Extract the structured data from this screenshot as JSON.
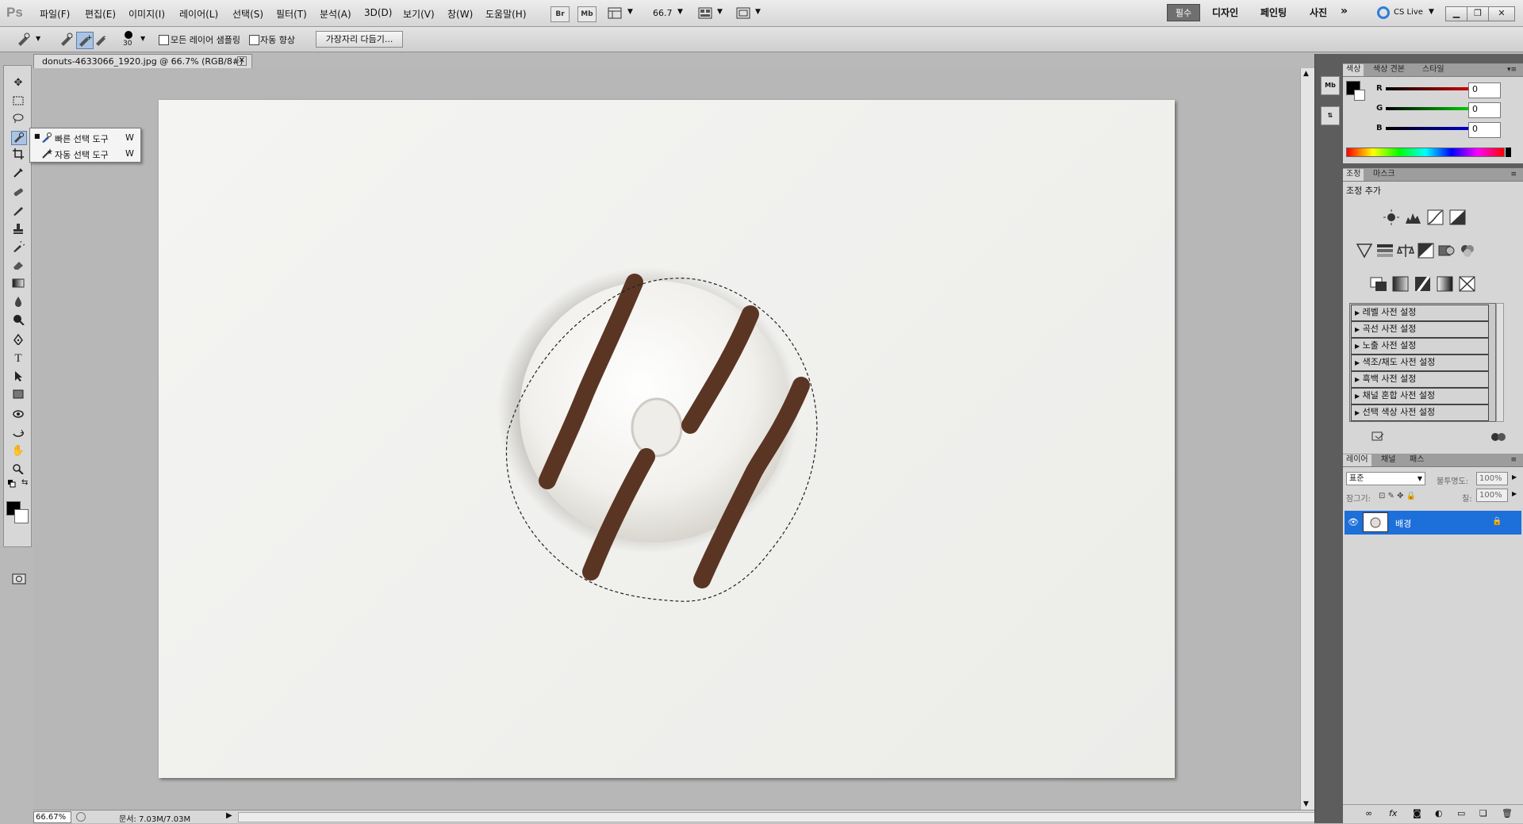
{
  "app": {
    "logo": "Ps"
  },
  "menu": [
    "파일(F)",
    "편집(E)",
    "이미지(I)",
    "레이어(L)",
    "선택(S)",
    "필터(T)",
    "분석(A)",
    "3D(D)",
    "보기(V)",
    "창(W)",
    "도움말(H)"
  ],
  "appbar": {
    "bridge": "Br",
    "minibridge": "Mb",
    "zoom": "66.7"
  },
  "workspaces": [
    "필수",
    "디자인",
    "페인팅",
    "사진"
  ],
  "cslive": "CS Live",
  "options": {
    "brush_size": "30",
    "sample_all_layers": "모든 레이어 샘플링",
    "auto_enhance": "자동 향상",
    "refine_edge": "가장자리 다듬기..."
  },
  "flyout": {
    "items": [
      {
        "label": "빠른 선택 도구",
        "key": "W"
      },
      {
        "label": "자동 선택 도구",
        "key": "W"
      }
    ]
  },
  "document": {
    "tab_title": "donuts-4633066_1920.jpg @ 66.7% (RGB/8#)"
  },
  "status": {
    "zoom": "66.67%",
    "doc_size": "문서: 7.03M/7.03M"
  },
  "color_panel": {
    "tabs": [
      "색상",
      "색상 견본",
      "스타일"
    ],
    "r": "0",
    "g": "0",
    "b": "0",
    "labels": [
      "R",
      "G",
      "B"
    ]
  },
  "adjust_panel": {
    "tabs": [
      "조정",
      "마스크"
    ],
    "heading": "조정 추가",
    "presets": [
      "레벨 사전 설정",
      "곡선 사전 설정",
      "노출 사전 설정",
      "색조/채도 사전 설정",
      "흑백 사전 설정",
      "채널 혼합 사전 설정",
      "선택 색상 사전 설정"
    ]
  },
  "layers_panel": {
    "tabs": [
      "레이어",
      "채널",
      "패스"
    ],
    "blend_mode": "표준",
    "opacity_label": "불투명도:",
    "opacity": "100%",
    "lock_label": "잠그기:",
    "fill_label": "칠:",
    "fill": "100%",
    "layer_name": "배경"
  },
  "colors": {
    "selection_blue": "#1d6fd9",
    "panel_bg": "#d6d6d6",
    "chrome_dark": "#5e5e5e"
  }
}
